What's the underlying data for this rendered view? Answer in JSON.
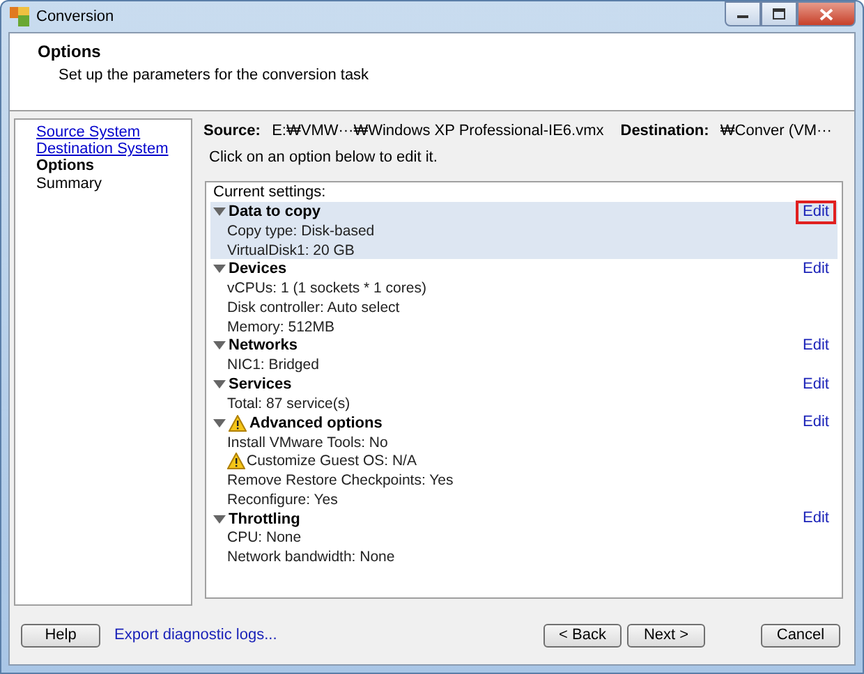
{
  "window": {
    "title": "Conversion"
  },
  "header": {
    "title": "Options",
    "subtitle": "Set up the parameters for the conversion task"
  },
  "nav": [
    {
      "label": "Source System",
      "kind": "link"
    },
    {
      "label": "Destination System",
      "kind": "link"
    },
    {
      "label": "Options",
      "kind": "current"
    },
    {
      "label": "Summary",
      "kind": "plain"
    }
  ],
  "source": {
    "label": "Source:",
    "value": "E:₩VMW···₩Windows XP Professional-IE6.vmx"
  },
  "destination": {
    "label": "Destination:",
    "value": "₩Conver (VM···"
  },
  "instruction": "Click on an option below to edit it.",
  "settings": {
    "caption": "Current settings:",
    "sections": [
      {
        "title": "Data to copy",
        "warning": false,
        "selected": true,
        "edit": "Edit",
        "items": [
          {
            "text": "Copy type: Disk-based",
            "warning": false
          },
          {
            "text": "VirtualDisk1: 20 GB",
            "warning": false
          }
        ]
      },
      {
        "title": "Devices",
        "warning": false,
        "selected": false,
        "edit": "Edit",
        "items": [
          {
            "text": "vCPUs: 1 (1 sockets * 1 cores)",
            "warning": false
          },
          {
            "text": "Disk controller: Auto select",
            "warning": false
          },
          {
            "text": "Memory: 512MB",
            "warning": false
          }
        ]
      },
      {
        "title": "Networks",
        "warning": false,
        "selected": false,
        "edit": "Edit",
        "items": [
          {
            "text": "NIC1: Bridged",
            "warning": false
          }
        ]
      },
      {
        "title": "Services",
        "warning": false,
        "selected": false,
        "edit": "Edit",
        "items": [
          {
            "text": "Total: 87 service(s)",
            "warning": false
          }
        ]
      },
      {
        "title": "Advanced options",
        "warning": true,
        "selected": false,
        "edit": "Edit",
        "items": [
          {
            "text": "Install VMware Tools: No",
            "warning": false
          },
          {
            "text": "Customize Guest OS: N/A",
            "warning": true
          },
          {
            "text": "Remove Restore Checkpoints: Yes",
            "warning": false
          },
          {
            "text": "Reconfigure: Yes",
            "warning": false
          }
        ]
      },
      {
        "title": "Throttling",
        "warning": false,
        "selected": false,
        "edit": "Edit",
        "items": [
          {
            "text": "CPU: None",
            "warning": false
          },
          {
            "text": "Network bandwidth: None",
            "warning": false
          }
        ]
      }
    ]
  },
  "footer": {
    "help": "Help",
    "export_link": "Export diagnostic logs...",
    "back": "< Back",
    "next": "Next >",
    "cancel": "Cancel"
  }
}
